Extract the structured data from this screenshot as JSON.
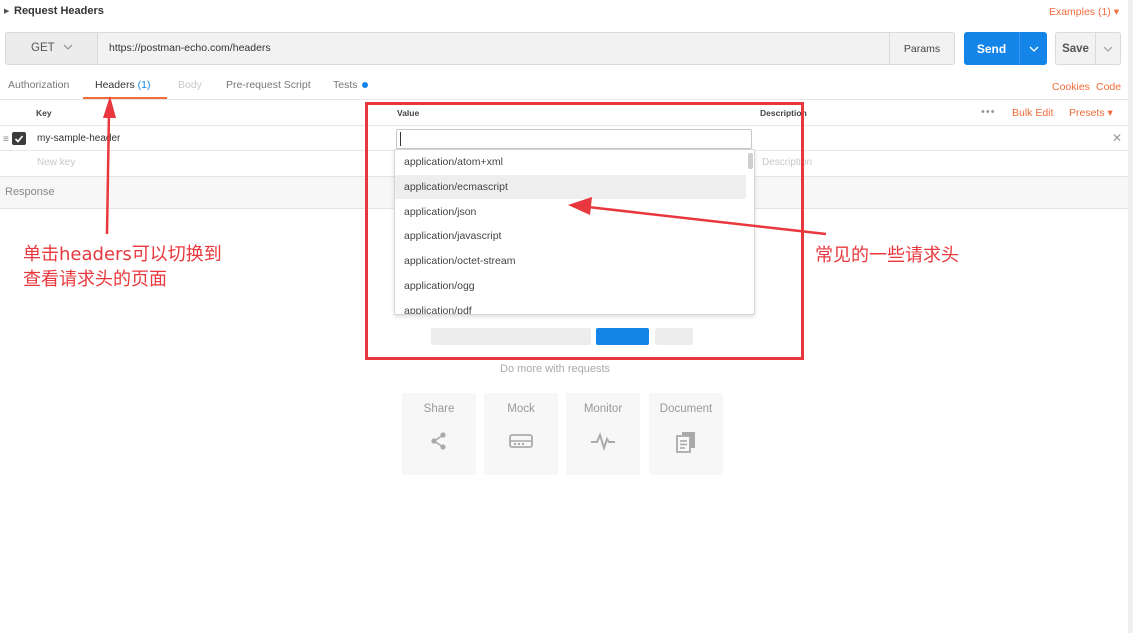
{
  "title": "Request Headers",
  "examples_link": "Examples (1) ▾",
  "request": {
    "method": "GET",
    "url": "https://postman-echo.com/headers",
    "params_label": "Params",
    "send_label": "Send",
    "save_label": "Save"
  },
  "tabs": {
    "authorization": "Authorization",
    "headers": "Headers",
    "headers_count": "(1)",
    "body": "Body",
    "prerequest": "Pre-request Script",
    "tests": "Tests"
  },
  "links": {
    "cookies": "Cookies",
    "code": "Code",
    "bulk_edit": "Bulk Edit",
    "presets": "Presets ▾"
  },
  "table": {
    "col_key": "Key",
    "col_value": "Value",
    "col_description": "Description",
    "row1_key": "my-sample-header",
    "new_key_placeholder": "New key",
    "description_placeholder": "Description"
  },
  "response_label": "Response",
  "dropdown_options": [
    "application/atom+xml",
    "application/ecmascript",
    "application/json",
    "application/javascript",
    "application/octet-stream",
    "application/ogg",
    "application/pdf"
  ],
  "highlighted_option_index": 1,
  "do_more_label": "Do more with requests",
  "cards": {
    "share": "Share",
    "mock": "Mock",
    "monitor": "Monitor",
    "document": "Document"
  },
  "annotations": {
    "left_line1": "单击headers可以切换到",
    "left_line2": "查看请求头的页面",
    "right": "常见的一些请求头"
  },
  "colors": {
    "accent_orange": "#f26b3a",
    "send_blue": "#1584e8",
    "annotation_red": "#e8383d"
  }
}
